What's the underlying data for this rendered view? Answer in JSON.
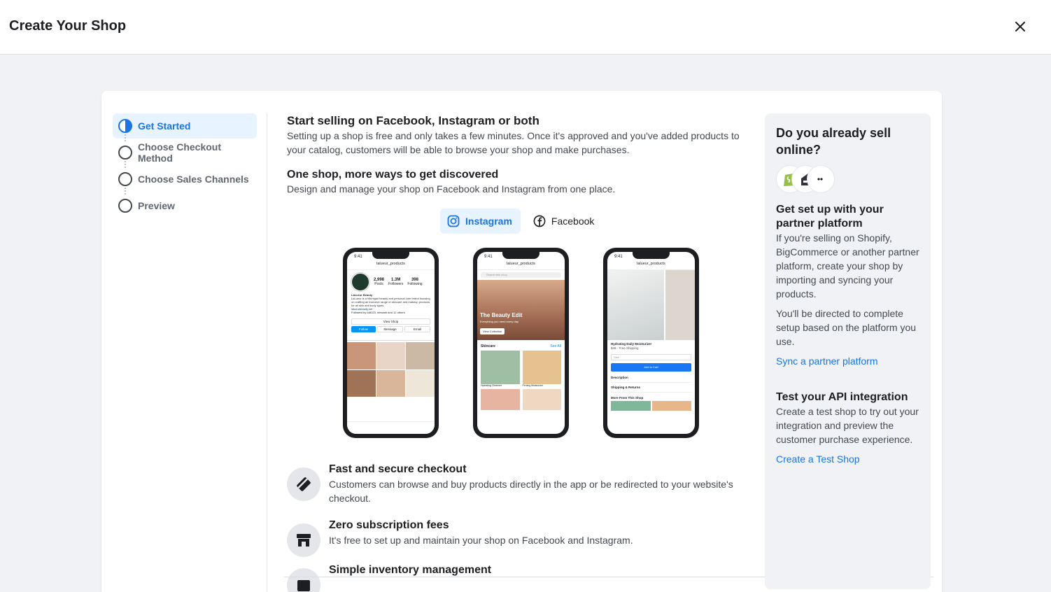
{
  "header": {
    "title": "Create Your Shop"
  },
  "steps": [
    {
      "label": "Get Started"
    },
    {
      "label": "Choose Checkout Method"
    },
    {
      "label": "Choose Sales Channels"
    },
    {
      "label": "Preview"
    }
  ],
  "main": {
    "title": "Start selling on Facebook, Instagram or both",
    "intro": "Setting up a shop is free and only takes a few minutes. Once it's approved and you've added products to your catalog, customers will be able to browse your shop and make purchases.",
    "subtitle": "One shop, more ways to get discovered",
    "subtext": "Design and manage your shop on Facebook and Instagram from one place.",
    "toggle": {
      "instagram": "Instagram",
      "facebook": "Facebook",
      "selected": "Instagram"
    },
    "phones": {
      "p1": {
        "time": "9:41",
        "handle": "lalueur_products",
        "posts_n": "2,998",
        "posts_l": "Posts",
        "followers_n": "1.3M",
        "followers_l": "Followers",
        "following_n": "398",
        "following_l": "Following",
        "name": "LaLueur Beauty",
        "bio": "LaLueur is a Michigan beauty and personal care brand focusing on crafting an inclusive range of skincare and makeup products for all skin and body types.",
        "link": "lalueurbeauty.net",
        "followed": "Followed by lolli323, elesanb and 12 others",
        "view_shop": "View Shop",
        "follow": "Follow",
        "message": "Message",
        "email": "Email"
      },
      "p2": {
        "time": "9:41",
        "handle": "lalueur_products",
        "search": "Search this shop",
        "edit_title": "The Beauty Edit",
        "edit_sub": "Everything you need every day",
        "view_collection": "View Collection",
        "section": "Skincare",
        "see_all": "See All",
        "item1": "Hydrating Cleanser",
        "item2": "Firming Moisturizer"
      },
      "p3": {
        "time": "9:41",
        "handle": "lalueur_products",
        "product": "Hydrating Daily Moisturizer",
        "price": "$48 · Free Shipping",
        "size": "Size",
        "add": "Add to Cart",
        "description": "Description",
        "shipping": "Shipping & Returns",
        "more": "More From This Shop"
      }
    }
  },
  "features": [
    {
      "title": "Fast and secure checkout",
      "text": "Customers can browse and buy products directly in the app or be redirected to your website's checkout."
    },
    {
      "title": "Zero subscription fees",
      "text": "It's free to set up and maintain your shop on Facebook and Instagram."
    },
    {
      "title": "Simple inventory management",
      "text": ""
    }
  ],
  "right": {
    "heading": "Do you already sell online?",
    "partner_title": "Get set up with your partner platform",
    "partner_text": "If you're selling on Shopify, BigCommerce or another partner platform, create your shop by importing and syncing your products.",
    "partner_text2": "You'll be directed to complete setup based on the platform you use.",
    "partner_link": "Sync a partner platform",
    "api_title": "Test your API integration",
    "api_text": "Create a test shop to try out your integration and preview the customer purchase experience.",
    "api_link": "Create a Test Shop"
  },
  "icons": {
    "close": "close-icon",
    "instagram": "instagram-icon",
    "facebook": "facebook-icon",
    "checkout": "card-icon",
    "fees": "store-icon",
    "inventory": "box-icon"
  },
  "colors": {
    "accent": "#1b74e4",
    "accent_bg": "#e7f3ff",
    "page_bg": "#f0f2f5"
  }
}
